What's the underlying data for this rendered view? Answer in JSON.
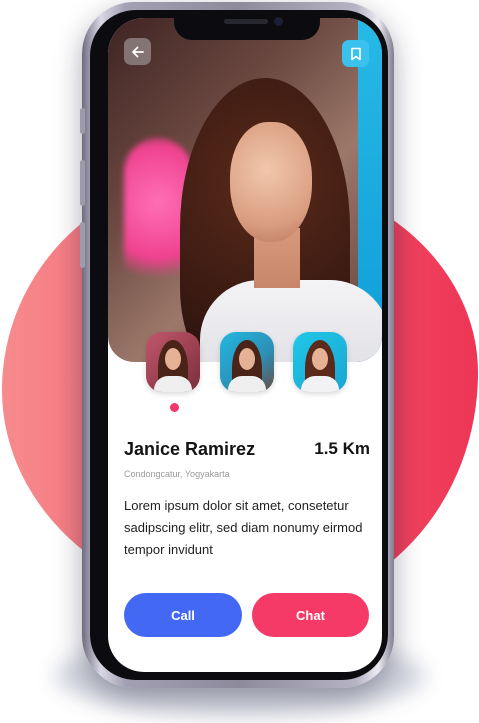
{
  "colors": {
    "backdrop": "#f3606f",
    "call": "#4268f4",
    "chat": "#f53a68",
    "dot": "#f0386b",
    "bookmark_bg": "#3bc1ee"
  },
  "header": {
    "back_icon": "arrow-left-icon",
    "bookmark_icon": "bookmark-icon"
  },
  "gallery": {
    "active_index": 0,
    "thumbnails": [
      "photo-1",
      "photo-2",
      "photo-3"
    ]
  },
  "profile": {
    "name": "Janice Ramirez",
    "distance": "1.5 Km",
    "location": "Condongcatur, Yogyakarta",
    "bio": "Lorem ipsum dolor sit amet, consetetur sadipscing elitr, sed diam nonumy eirmod tempor invidunt"
  },
  "actions": {
    "call_label": "Call",
    "chat_label": "Chat"
  }
}
